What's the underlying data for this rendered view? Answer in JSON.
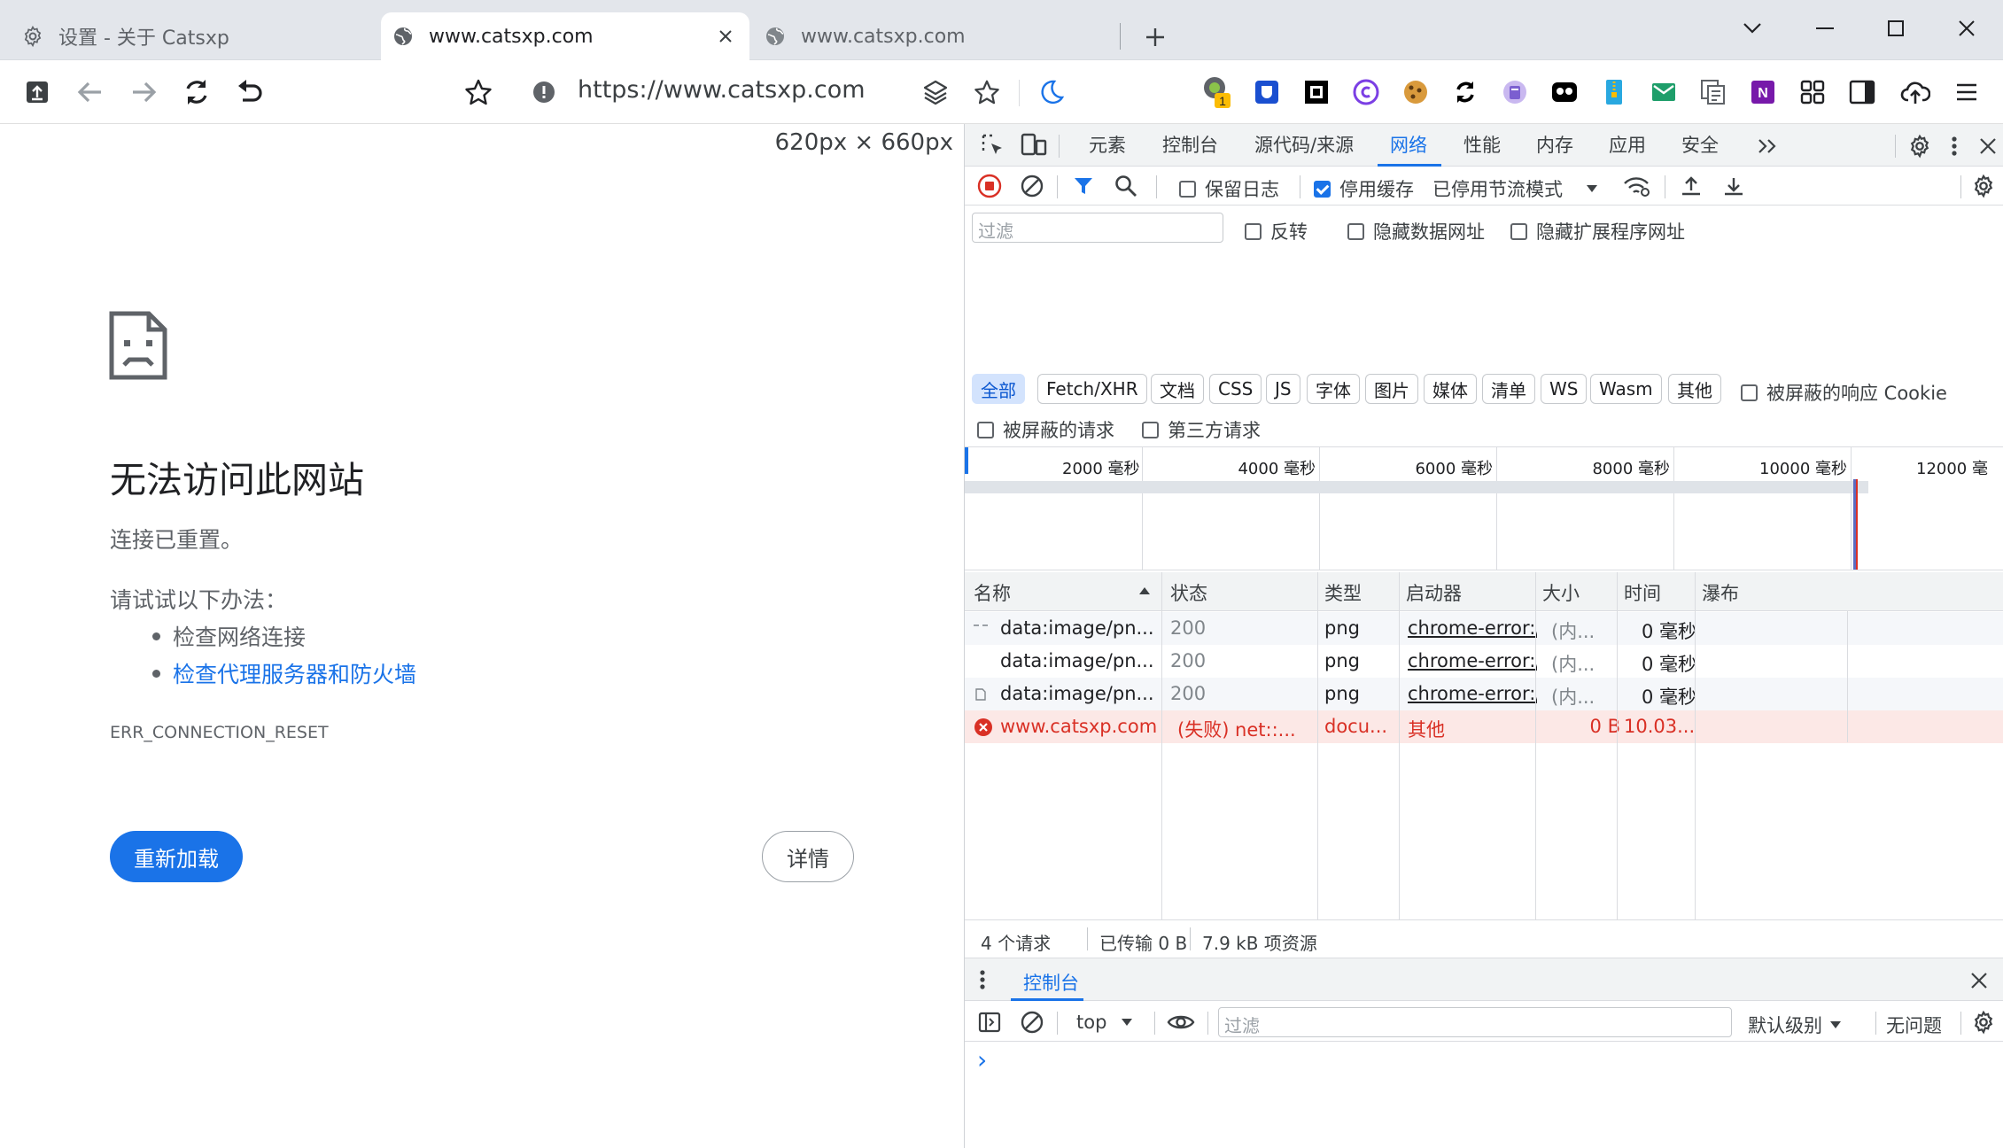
{
  "tabs": [
    {
      "title": "设置 - 关于 Catsxp"
    },
    {
      "title": "www.catsxp.com"
    },
    {
      "title": "www.catsxp.com"
    }
  ],
  "toolbar": {
    "url": "https://www.catsxp.com",
    "extension_badge": "1"
  },
  "viewport_size": "620px × 660px",
  "error_page": {
    "heading": "无法访问此网站",
    "subtext": "连接已重置。",
    "try_label": "请试试以下办法：",
    "suggestions": [
      "检查网络连接",
      "检查代理服务器和防火墙"
    ],
    "error_code": "ERR_CONNECTION_RESET",
    "reload_button": "重新加载",
    "details_button": "详情"
  },
  "devtools": {
    "tabs": [
      "元素",
      "控制台",
      "源代码/来源",
      "网络",
      "性能",
      "内存",
      "应用",
      "安全"
    ],
    "active_tab": "网络",
    "network_toolbar": {
      "preserve_log": "保留日志",
      "disable_cache": "停用缓存",
      "throttling": "已停用节流模式"
    },
    "filter": {
      "placeholder": "过滤",
      "invert": "反转",
      "hide_data_urls": "隐藏数据网址",
      "hide_extension_urls": "隐藏扩展程序网址",
      "types": [
        "全部",
        "Fetch/XHR",
        "文档",
        "CSS",
        "JS",
        "字体",
        "图片",
        "媒体",
        "清单",
        "WS",
        "Wasm",
        "其他"
      ],
      "blocked_cookies": "被屏蔽的响应 Cookie",
      "blocked_requests": "被屏蔽的请求",
      "third_party": "第三方请求"
    },
    "timeline_ticks": [
      "2000 毫秒",
      "4000 毫秒",
      "6000 毫秒",
      "8000 毫秒",
      "10000 毫秒",
      "12000 毫"
    ],
    "columns": [
      "名称",
      "状态",
      "类型",
      "启动器",
      "大小",
      "时间",
      "瀑布"
    ],
    "requests": [
      {
        "name": "data:image/pn...",
        "status": "200",
        "type": "png",
        "initiator": "chrome-error:/",
        "size": "(内...",
        "time": "0 毫秒"
      },
      {
        "name": "data:image/pn...",
        "status": "200",
        "type": "png",
        "initiator": "chrome-error:/",
        "size": "(内...",
        "time": "0 毫秒"
      },
      {
        "name": "data:image/pn...",
        "status": "200",
        "type": "png",
        "initiator": "chrome-error:/",
        "size": "(内...",
        "time": "0 毫秒"
      },
      {
        "name": "www.catsxp.com",
        "status": "(失败)  net::...",
        "type": "docu...",
        "initiator": "其他",
        "size": "0 B",
        "time": "10.03..."
      }
    ],
    "summary": {
      "requests": "4 个请求",
      "transferred": "已传输 0 B",
      "resources": "7.9 kB 项资源"
    },
    "drawer": {
      "tab": "控制台",
      "context": "top",
      "filter_placeholder": "过滤",
      "level": "默认级别",
      "issues": "无问题",
      "prompt": "›"
    }
  },
  "colors": {
    "accent": "#1a73e8",
    "error": "#d93025",
    "error_row_bg": "#fce8e6",
    "selected_chip": "#d3e3fd"
  }
}
